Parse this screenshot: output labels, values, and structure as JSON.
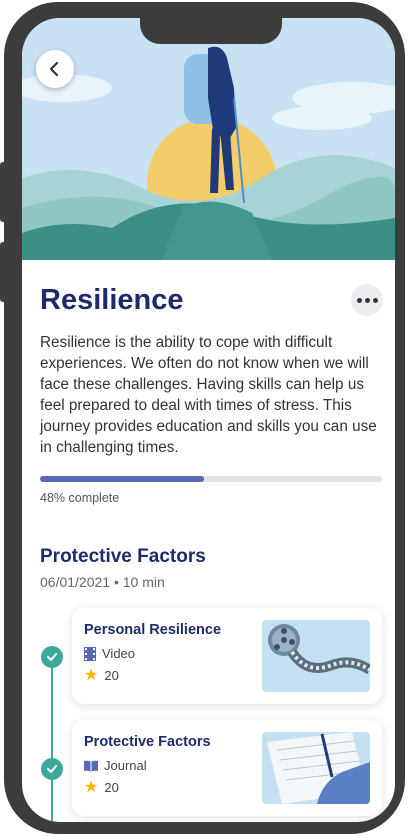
{
  "header": {
    "title": "Resilience"
  },
  "description": "Resilience is the ability to cope with difficult experiences. We often do not know when we will face these challenges. Having skills can help us feel prepared to deal with times of stress. This journey provides education and skills you can use in challenging times.",
  "progress": {
    "value": 0.48,
    "label": "48% complete"
  },
  "section": {
    "title": "Protective Factors",
    "date": "06/01/2021",
    "duration": "10 min"
  },
  "items": [
    {
      "title": "Personal Resilience",
      "type": "Video",
      "type_icon": "film-icon",
      "points": "20",
      "completed": true
    },
    {
      "title": "Protective Factors",
      "type": "Journal",
      "type_icon": "book-icon",
      "points": "20",
      "completed": true
    }
  ],
  "colors": {
    "accent": "#1f2a6b",
    "progress": "#5a69b4",
    "teal": "#3fa79a",
    "star": "#f5b800"
  }
}
